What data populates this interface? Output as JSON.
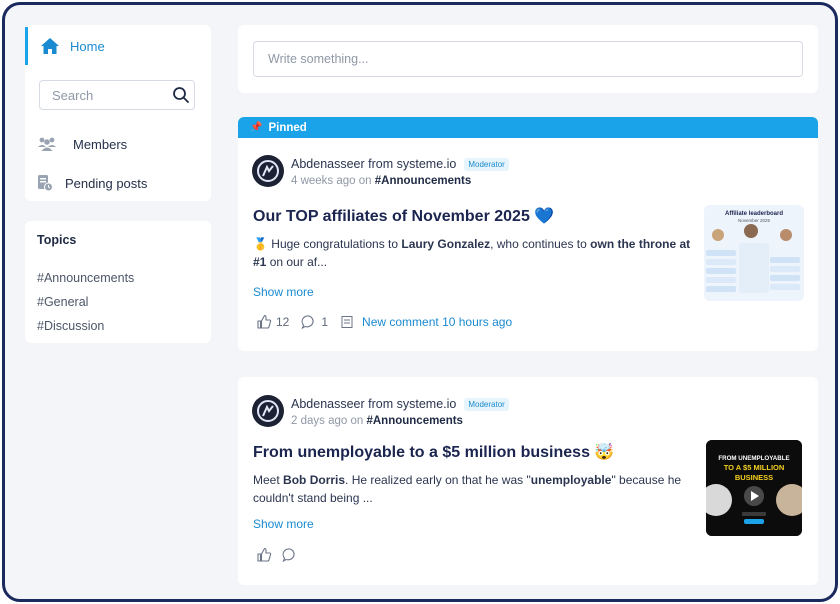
{
  "sidebar": {
    "home_label": "Home",
    "search_placeholder": "Search",
    "members_label": "Members",
    "pending_label": "Pending posts"
  },
  "topics": {
    "title": "Topics",
    "items": [
      "#Announcements",
      "#General",
      "#Discussion"
    ]
  },
  "composer": {
    "placeholder": "Write something..."
  },
  "posts": [
    {
      "pinned_label": "Pinned",
      "author": "Abdenasseer from systeme.io",
      "badge": "Moderator",
      "time": "4 weeks ago",
      "on": "on",
      "topic": "#Announcements",
      "title": "Our TOP affiliates of November 2025 💙",
      "excerpt_emoji": "🥇",
      "excerpt_1": "Huge congratulations to",
      "excerpt_name": "Laury Gonzalez",
      "excerpt_2": ", who continues to",
      "excerpt_bold": "own the throne at #1",
      "excerpt_3": "on our af...",
      "show_more": "Show more",
      "likes": "12",
      "comments": "1",
      "new_comment": "New comment 10 hours ago",
      "thumb_title": "Affiliate leaderboard",
      "thumb_sub": "November 2025"
    },
    {
      "author": "Abdenasseer from systeme.io",
      "badge": "Moderator",
      "time": "2 days ago",
      "on": "on",
      "topic": "#Announcements",
      "title": "From unemployable to a $5 million business 🤯",
      "excerpt_1": "Meet",
      "excerpt_name": "Bob Dorris",
      "excerpt_2": ". He realized early on that he was \"",
      "excerpt_bold": "unemployable",
      "excerpt_3": "\" because he couldn't stand being ...",
      "show_more": "Show more",
      "thumb_line1": "FROM UNEMPLOYABLE",
      "thumb_line2": "TO A $5 MILLION",
      "thumb_line3": "BUSINESS"
    }
  ],
  "colors": {
    "accent": "#1aa3e8",
    "link": "#1a8ad0",
    "frame": "#1b2a5e"
  }
}
